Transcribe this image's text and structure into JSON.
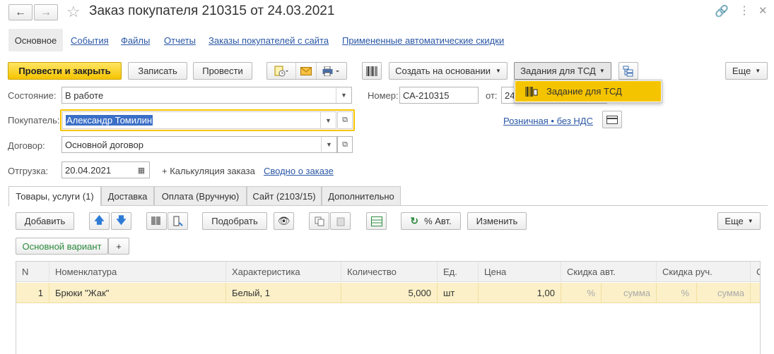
{
  "window": {
    "title": "Заказ покупателя 210315 от 24.03.2021"
  },
  "nav_tabs": [
    "Основное",
    "События",
    "Файлы",
    "Отчеты",
    "Заказы покупателей с сайта",
    "Примененные автоматические скидки"
  ],
  "toolbar": {
    "post_close": "Провести и закрыть",
    "save": "Записать",
    "post": "Провести",
    "create_based": "Создать на основании",
    "tsd_tasks": "Задания для ТСД",
    "more": "Еще"
  },
  "dropdown_menu": {
    "item": "Задание для ТСД"
  },
  "form": {
    "state_label": "Состояние:",
    "state_value": "В работе",
    "number_label": "Номер:",
    "number_value": "СА-210315",
    "date_label": "от:",
    "date_value": "24",
    "buyer_label": "Покупатель:",
    "buyer_value": "Александр Томилин",
    "price_type_link": "Розничная • без НДС",
    "contract_label": "Договор:",
    "contract_value": "Основной договор",
    "shipment_label": "Отгрузка:",
    "shipment_value": "20.04.2021",
    "calc_text": "+ Калькуляция заказа",
    "summary_link": "Сводно о заказе"
  },
  "section_tabs": [
    "Товары, услуги (1)",
    "Доставка",
    "Оплата (Вручную)",
    "Сайт (2103/15)",
    "Дополнительно"
  ],
  "items_toolbar": {
    "add": "Добавить",
    "pick": "Подобрать",
    "auto_discount": "% Авт.",
    "change": "Изменить",
    "more": "Еще"
  },
  "variant": {
    "label": "Основной вариант",
    "plus": "+"
  },
  "table": {
    "columns": [
      "N",
      "Номенклатура",
      "Характеристика",
      "Количество",
      "Ед.",
      "Цена",
      "Скидка авт.",
      "Скидка руч.",
      "С"
    ],
    "rows": [
      {
        "n": "1",
        "item": "Брюки \"Жак\"",
        "char": "Белый, 1",
        "qty": "5,000",
        "unit": "шт",
        "price": "1,00",
        "auto_pct": "%",
        "auto_sum": "сумма",
        "man_pct": "%",
        "man_sum": "сумма"
      }
    ]
  },
  "colors": {
    "accent_yellow": "#f5c400",
    "link_blue": "#2a57a6",
    "row_highlight": "#fbf0c8"
  }
}
